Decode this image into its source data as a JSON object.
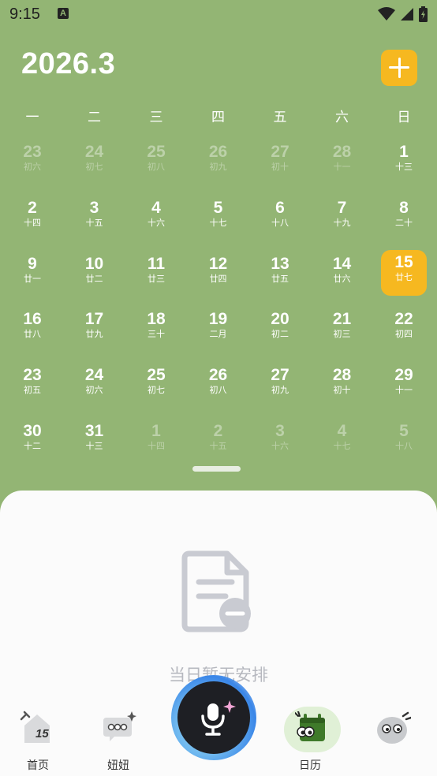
{
  "status_bar": {
    "time": "9:15",
    "badge": "A"
  },
  "header": {
    "month": "2026.3",
    "add_icon": "plus-icon"
  },
  "weekdays": [
    "一",
    "二",
    "三",
    "四",
    "五",
    "六",
    "日"
  ],
  "calendar": {
    "rows": [
      [
        {
          "d": "23",
          "l": "初六",
          "faded": true
        },
        {
          "d": "24",
          "l": "初七",
          "faded": true
        },
        {
          "d": "25",
          "l": "初八",
          "faded": true
        },
        {
          "d": "26",
          "l": "初九",
          "faded": true
        },
        {
          "d": "27",
          "l": "初十",
          "faded": true
        },
        {
          "d": "28",
          "l": "十一",
          "faded": true
        },
        {
          "d": "1",
          "l": "十三"
        }
      ],
      [
        {
          "d": "2",
          "l": "十四"
        },
        {
          "d": "3",
          "l": "十五"
        },
        {
          "d": "4",
          "l": "十六"
        },
        {
          "d": "5",
          "l": "十七"
        },
        {
          "d": "6",
          "l": "十八"
        },
        {
          "d": "7",
          "l": "十九"
        },
        {
          "d": "8",
          "l": "二十"
        }
      ],
      [
        {
          "d": "9",
          "l": "廿一"
        },
        {
          "d": "10",
          "l": "廿二"
        },
        {
          "d": "11",
          "l": "廿三"
        },
        {
          "d": "12",
          "l": "廿四"
        },
        {
          "d": "13",
          "l": "廿五"
        },
        {
          "d": "14",
          "l": "廿六"
        },
        {
          "d": "15",
          "l": "廿七",
          "today": true
        }
      ],
      [
        {
          "d": "16",
          "l": "廿八"
        },
        {
          "d": "17",
          "l": "廿九"
        },
        {
          "d": "18",
          "l": "三十"
        },
        {
          "d": "19",
          "l": "二月"
        },
        {
          "d": "20",
          "l": "初二"
        },
        {
          "d": "21",
          "l": "初三"
        },
        {
          "d": "22",
          "l": "初四"
        }
      ],
      [
        {
          "d": "23",
          "l": "初五"
        },
        {
          "d": "24",
          "l": "初六"
        },
        {
          "d": "25",
          "l": "初七"
        },
        {
          "d": "26",
          "l": "初八"
        },
        {
          "d": "27",
          "l": "初九"
        },
        {
          "d": "28",
          "l": "初十"
        },
        {
          "d": "29",
          "l": "十一"
        }
      ],
      [
        {
          "d": "30",
          "l": "十二"
        },
        {
          "d": "31",
          "l": "十三"
        },
        {
          "d": "1",
          "l": "十四",
          "faded": true
        },
        {
          "d": "2",
          "l": "十五",
          "faded": true
        },
        {
          "d": "3",
          "l": "十六",
          "faded": true
        },
        {
          "d": "4",
          "l": "十七",
          "faded": true
        },
        {
          "d": "5",
          "l": "十八",
          "faded": true
        }
      ]
    ],
    "today_color": "#f6b820",
    "background_color": "#93b574"
  },
  "empty_state": {
    "text": "当日暂无安排",
    "icon": "document-minus-icon"
  },
  "nav": {
    "home": {
      "label": "首页",
      "icon": "home-calendar-icon",
      "badge": "15"
    },
    "niuniu": {
      "label": "妞妞",
      "icon": "chat-bubble-icon"
    },
    "voice": {
      "icon": "microphone-icon"
    },
    "calendar": {
      "label": "日历",
      "icon": "calendar-icon"
    },
    "mascot": {
      "icon": "mascot-icon"
    }
  }
}
